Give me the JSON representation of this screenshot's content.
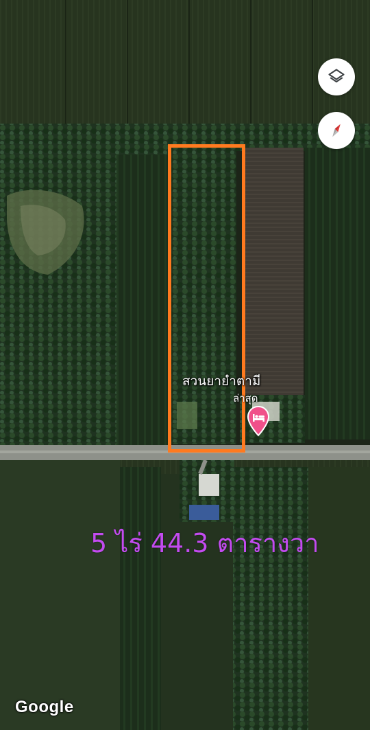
{
  "map": {
    "view": "satellite",
    "place_label": "สวนยายำตามี",
    "place_sublabel": "ล่าสุด",
    "area_text": "5 ไร่ 44.3 ตารางวา",
    "attribution": "Google"
  },
  "controls": {
    "layers_icon": "layers-icon",
    "compass_icon": "compass-icon"
  },
  "marker": {
    "icon": "hotel-bed-icon",
    "color": "#f0508a"
  },
  "colors": {
    "plot_outline": "#ff7a1f",
    "area_text": "#c34bf0"
  }
}
